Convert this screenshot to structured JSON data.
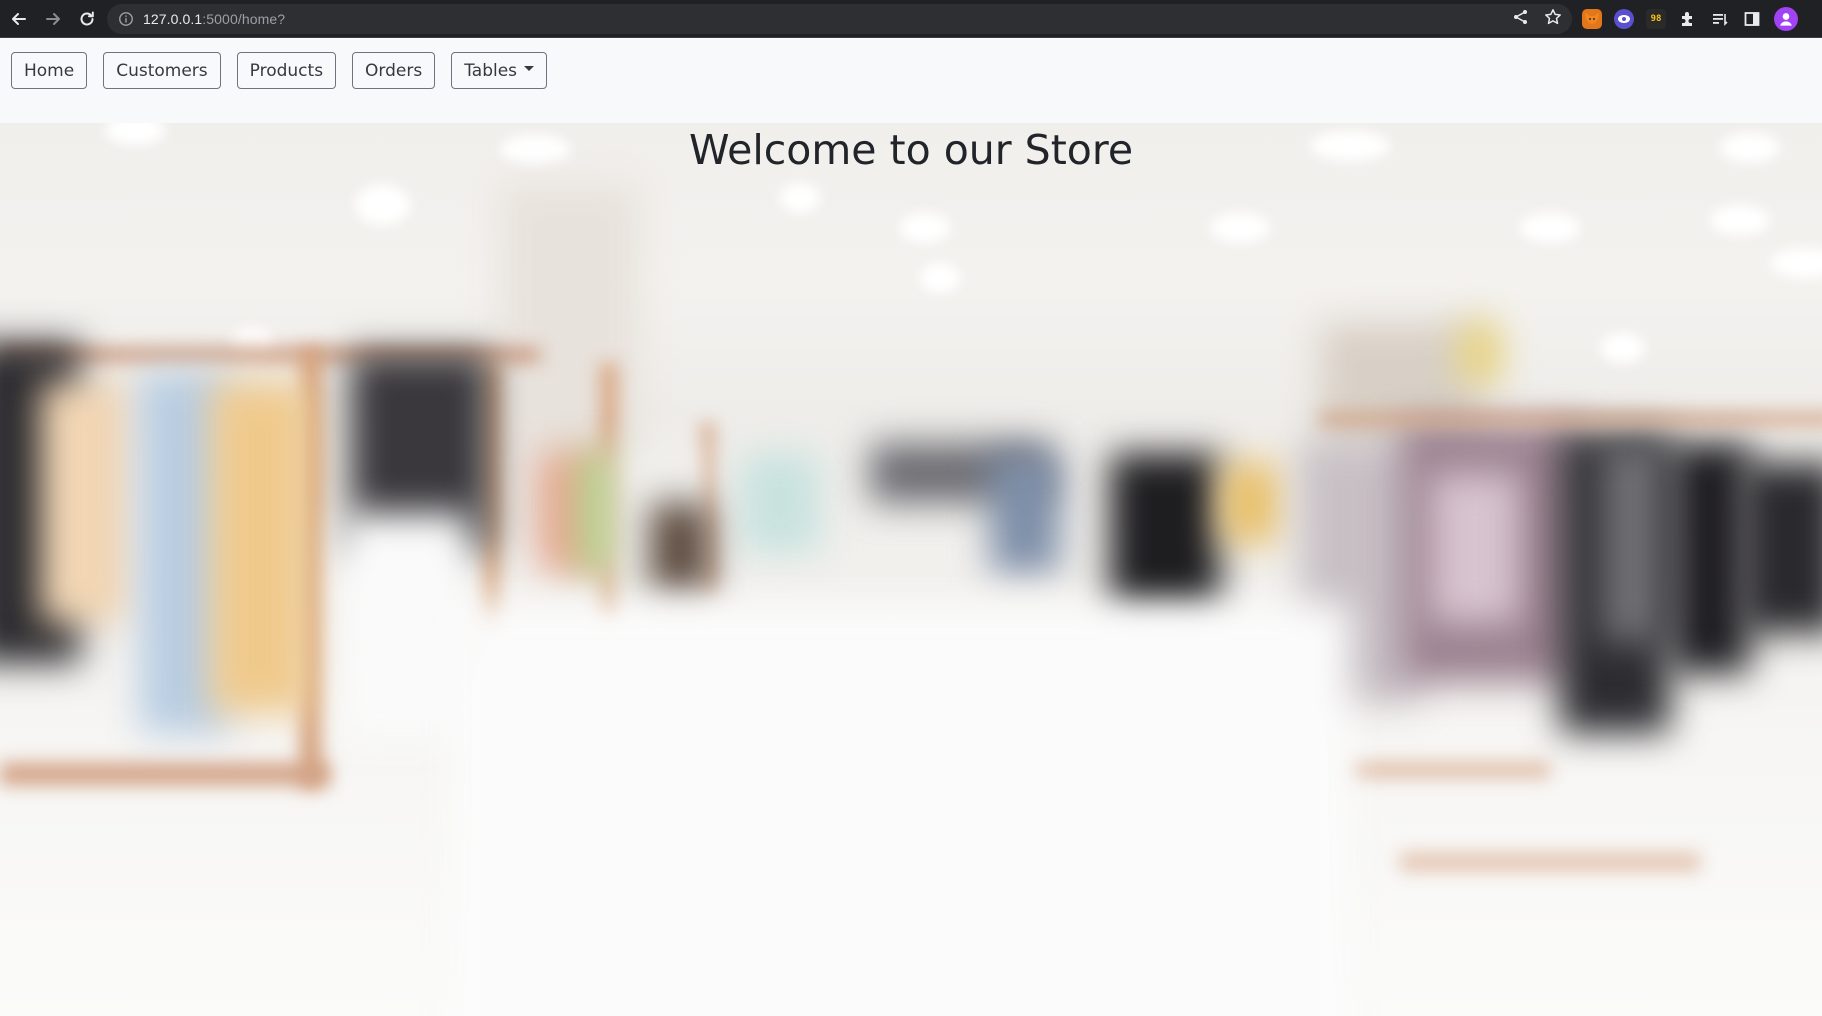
{
  "browser": {
    "url_host": "127.0.0.1",
    "url_rest": ":5000/home?",
    "extensions": [
      {
        "name": "fox-extension-icon"
      },
      {
        "name": "eye-extension-icon"
      },
      {
        "name": "badge-extension-icon",
        "label": "98"
      }
    ]
  },
  "navbar": {
    "items": [
      {
        "label": "Home"
      },
      {
        "label": "Customers"
      },
      {
        "label": "Products"
      },
      {
        "label": "Orders"
      }
    ],
    "dropdown": {
      "label": "Tables"
    }
  },
  "hero": {
    "title": "Welcome to our Store"
  },
  "colors": {
    "navbar_bg": "#f8f9fa",
    "button_border": "#6c757d",
    "text": "#212529"
  }
}
